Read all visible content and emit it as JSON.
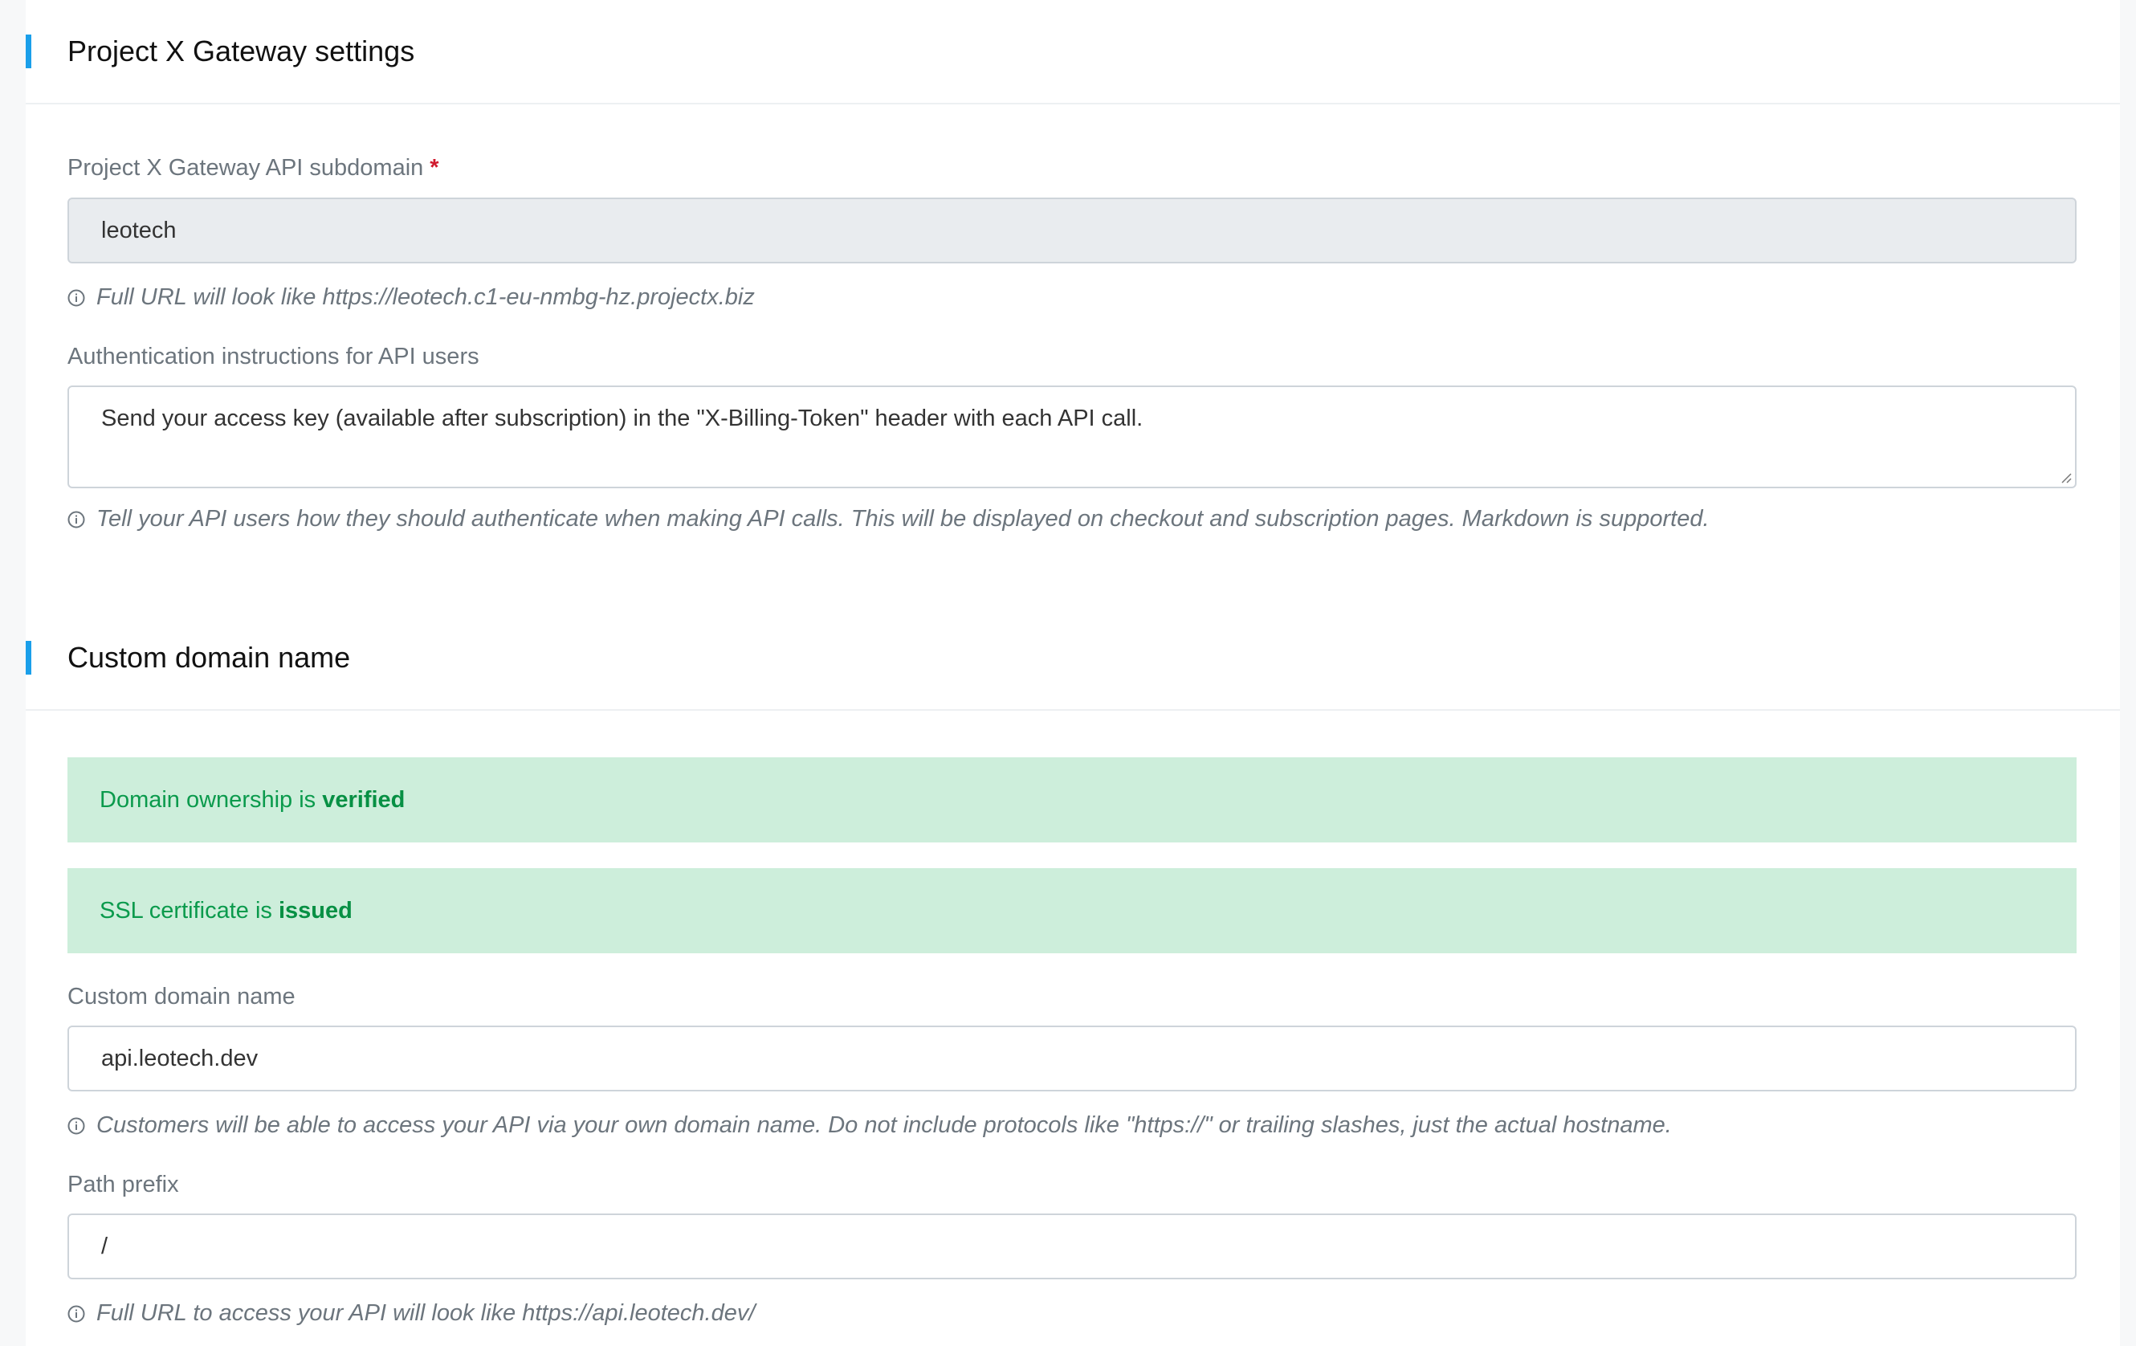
{
  "gateway_section": {
    "title": "Project X Gateway settings",
    "subdomain": {
      "label": "Project X Gateway API subdomain",
      "required_marker": "*",
      "value": "leotech",
      "help": "Full URL will look like https://leotech.c1-eu-nmbg-hz.projectx.biz"
    },
    "auth": {
      "label": "Authentication instructions for API users",
      "value": "Send your access key (available after subscription) in the \"X-Billing-Token\" header with each API call.",
      "help": "Tell your API users how they should authenticate when making API calls. This will be displayed on checkout and subscription pages. Markdown is supported."
    }
  },
  "domain_section": {
    "title": "Custom domain name",
    "alerts": [
      {
        "text": "Domain ownership is ",
        "status": "verified"
      },
      {
        "text": "SSL certificate is ",
        "status": "issued"
      }
    ],
    "custom_domain": {
      "label": "Custom domain name",
      "value": "api.leotech.dev",
      "help": "Customers will be able to access your API via your own domain name. Do not include protocols like \"https://\" or trailing slashes, just the actual hostname."
    },
    "path_prefix": {
      "label": "Path prefix",
      "value": "/",
      "help": "Full URL to access your API will look like https://api.leotech.dev/"
    }
  },
  "colors": {
    "accent": "#1a9fea",
    "success_bg": "#cdeedb",
    "success_text": "#0a9a4c",
    "required": "#d0192d"
  },
  "icons": {
    "help": "info-circle-icon",
    "resize": "resize-grip-icon"
  }
}
